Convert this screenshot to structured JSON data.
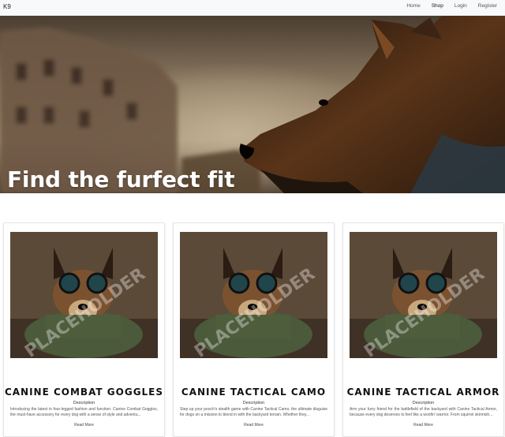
{
  "navbar": {
    "brand": "K9",
    "links": [
      "Home",
      "Shop",
      "Login",
      "Register"
    ],
    "active": "Shop"
  },
  "hero": {
    "title": "Find the furfect fit"
  },
  "products": [
    {
      "title": "CANINE COMBAT GOGGLES",
      "subtitle": "Description",
      "description": "Introducing the latest in four-legged fashion and function: Canine Combat Goggles, the must-have accessory for every dog with a sense of style and adventu...",
      "more": "Read More",
      "watermark": "PLACEHOLDER"
    },
    {
      "title": "CANINE TACTICAL CAMO",
      "subtitle": "Description",
      "description": "Step up your pooch's stealth game with Canine Tactical Camo, the ultimate disguise for dogs on a mission to blend in with the backyard terrain. Whether they...",
      "more": "Read More",
      "watermark": "PLACEHOLDER"
    },
    {
      "title": "CANINE TACTICAL ARMOR",
      "subtitle": "Description",
      "description": "Arm your furry friend for the battlefield of the backyard with Canine Tactical Armor, because every dog deserves to feel like a woofin' warrior. From squirrel skirmish...",
      "more": "Read More",
      "watermark": "PLACEHOLDER"
    }
  ],
  "colors": {
    "navbar_bg": "#f8f9fa",
    "hero_title": "#ffffff",
    "card_title": "#111111"
  }
}
